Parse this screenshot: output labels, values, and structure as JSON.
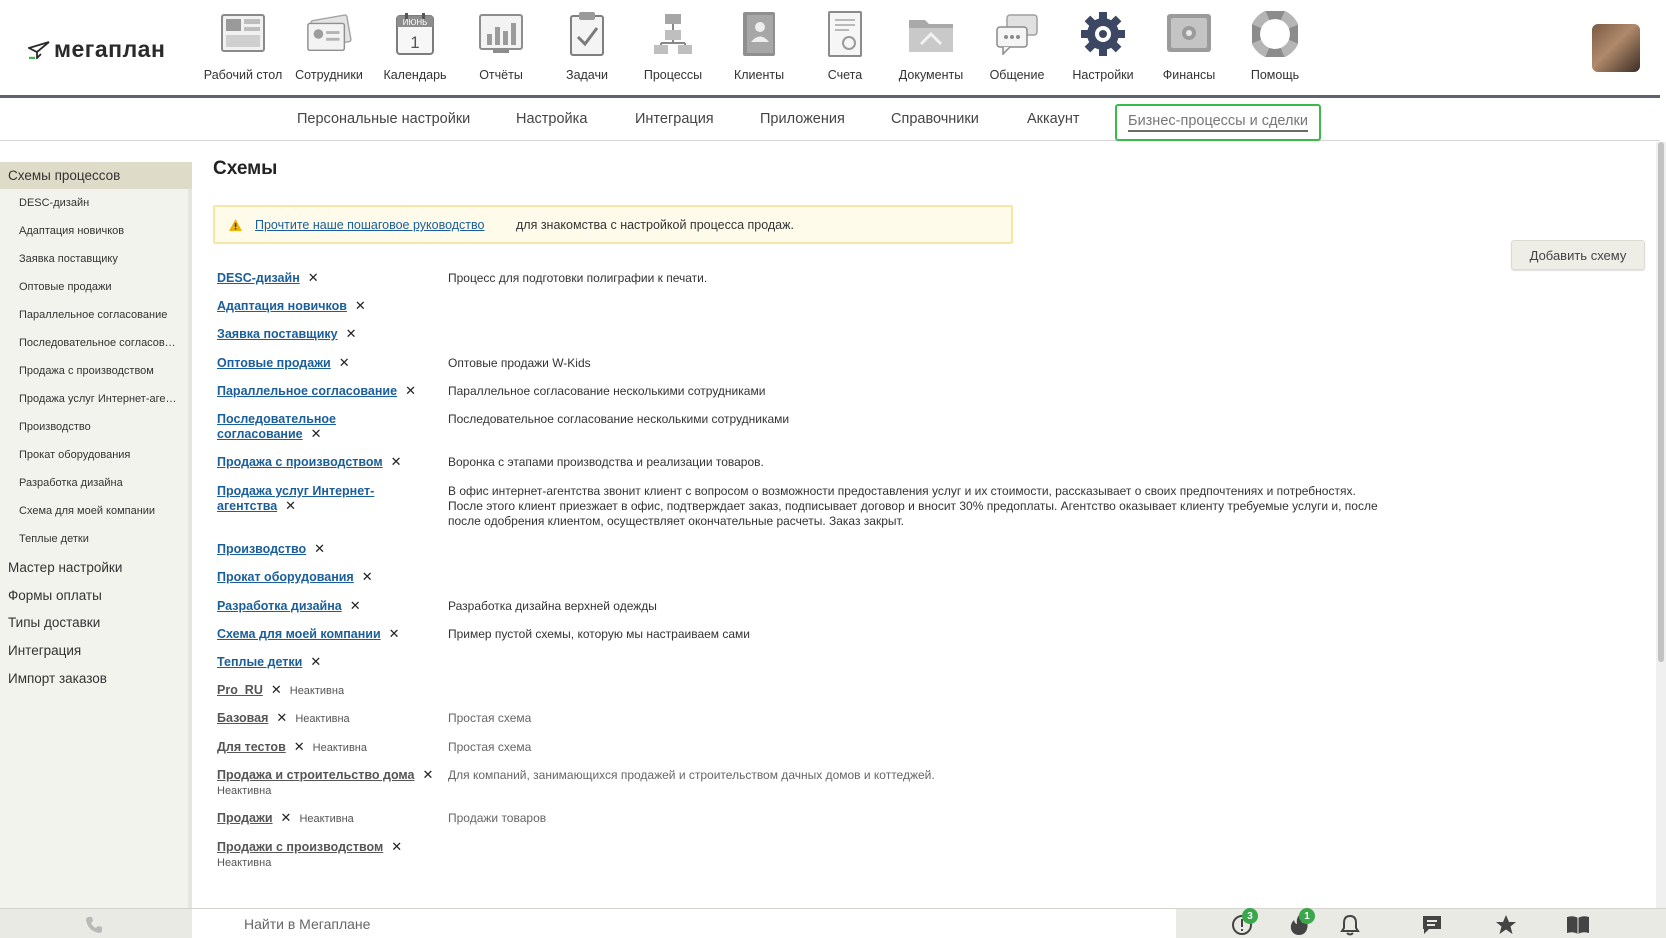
{
  "app": {
    "logo_text": "мегаплан"
  },
  "nav": [
    {
      "label": "Рабочий стол",
      "icon": "desktop-icon"
    },
    {
      "label": "Сотрудники",
      "icon": "employees-icon"
    },
    {
      "label": "Календарь",
      "icon": "calendar-icon"
    },
    {
      "label": "Отчёты",
      "icon": "reports-icon"
    },
    {
      "label": "Задачи",
      "icon": "tasks-icon"
    },
    {
      "label": "Процессы",
      "icon": "processes-icon"
    },
    {
      "label": "Клиенты",
      "icon": "clients-icon"
    },
    {
      "label": "Счета",
      "icon": "invoices-icon"
    },
    {
      "label": "Документы",
      "icon": "documents-icon"
    },
    {
      "label": "Общение",
      "icon": "chat-icon"
    },
    {
      "label": "Настройки",
      "icon": "settings-gear-icon"
    },
    {
      "label": "Финансы",
      "icon": "finance-safe-icon"
    },
    {
      "label": "Помощь",
      "icon": "help-lifebuoy-icon"
    }
  ],
  "calendar_icon": {
    "month": "ИЮНЬ",
    "day": "1"
  },
  "subnav": {
    "items": [
      "Персональные настройки",
      "Настройка",
      "Интеграция",
      "Приложения",
      "Справочники",
      "Аккаунт"
    ],
    "active": "Бизнес-процессы и сделки"
  },
  "sidebar": {
    "active": "Схемы процессов",
    "sub_items": [
      "DESC-дизайн",
      "Адаптация новичков",
      "Заявка поставщику",
      "Оптовые продажи",
      "Параллельное согласование",
      "Последовательное согласование",
      "Продажа с производством",
      "Продажа услуг Интернет-агентства",
      "Производство",
      "Прокат оборудования",
      "Разработка дизайна",
      "Схема для моей компании",
      "Теплые детки"
    ],
    "items": [
      "Мастер настройки",
      "Формы оплаты",
      "Типы доставки",
      "Интеграция",
      "Импорт заказов"
    ]
  },
  "main": {
    "title": "Схемы",
    "notice": {
      "link": "Прочтите наше пошаговое руководство",
      "text": "для знакомства с настройкой процесса продаж."
    },
    "add_button": "Добавить схему",
    "inactive_label": "Неактивна",
    "schemes": [
      {
        "name": "DESC-дизайн",
        "desc": "Процесс для подготовки полиграфии к печати.",
        "active": true
      },
      {
        "name": "Адаптация новичков",
        "desc": "",
        "active": true
      },
      {
        "name": "Заявка поставщику",
        "desc": "",
        "active": true
      },
      {
        "name": "Оптовые продажи",
        "desc": "Оптовые продажи W-Kids",
        "active": true
      },
      {
        "name": "Параллельное согласование",
        "desc": "Параллельное согласование несколькими сотрудниками",
        "active": true
      },
      {
        "name": "Последовательное согласование",
        "desc": "Последовательное согласование несколькими сотрудниками",
        "active": true
      },
      {
        "name": "Продажа с производством",
        "desc": "Воронка с этапами производства и реализации товаров.",
        "active": true
      },
      {
        "name": "Продажа услуг Интернет-агентства",
        "desc": "В офис интернет-агентства звонит клиент с вопросом о возможности предоставления услуг и их стоимости, рассказывает о своих предпочтениях и потребностях. После этого клиент приезжает в офис, подтверждает заказ, подписывает договор и вносит 30% предоплаты. Агентство оказывает клиенту требуемые услуги и, после после одобрения клиентом, осуществляет окончательные расчеты. Заказ закрыт.",
        "active": true
      },
      {
        "name": "Производство",
        "desc": "",
        "active": true
      },
      {
        "name": "Прокат оборудования",
        "desc": "",
        "active": true
      },
      {
        "name": "Разработка дизайна",
        "desc": "Разработка дизайна верхней одежды",
        "active": true
      },
      {
        "name": "Схема для моей компании",
        "desc": "Пример пустой схемы, которую мы настраиваем сами",
        "active": true
      },
      {
        "name": "Теплые детки",
        "desc": "",
        "active": true
      },
      {
        "name": "Pro_RU",
        "desc": "",
        "active": false
      },
      {
        "name": "Базовая",
        "desc": "Простая схема",
        "active": false
      },
      {
        "name": "Для тестов",
        "desc": "Простая схема",
        "active": false
      },
      {
        "name": "Продажа и строительство дома",
        "desc": "Для компаний, занимающихся продажей и строительством дачных домов и коттеджей.",
        "active": false
      },
      {
        "name": "Продажи",
        "desc": "Продажи товаров",
        "active": false
      },
      {
        "name": "Продажи с производством",
        "desc": "",
        "active": false
      }
    ]
  },
  "bottom": {
    "search_placeholder": "Найти в Мегаплане",
    "alerts_count": "3",
    "hot_count": "1"
  },
  "colors": {
    "accent_green": "#3bba4c",
    "link_blue": "#1a5e9a",
    "sidebar_bg": "#f3f3ee",
    "active_sidebar_bg": "#dedcc8"
  }
}
